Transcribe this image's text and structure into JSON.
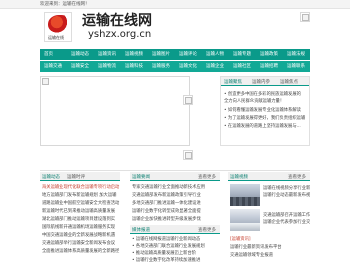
{
  "topbar": {
    "text": "欢迎来到：运输在线网！"
  },
  "header": {
    "title": "运输在线网",
    "domain": "yshzx.org.cn",
    "logo_seal": "运输在线"
  },
  "nav": {
    "row1": [
      "首页",
      "运输动态",
      "运输资讯",
      "运输视频",
      "运输图片",
      "运输评论",
      "运输人物",
      "运输专题",
      "运输政策",
      "运输法规"
    ],
    "row2": [
      "运输交通",
      "运输安全",
      "运输物流",
      "运输科技",
      "运输服务",
      "运输文化",
      "运输企业",
      "运输社区",
      "运输招聘",
      "运输联系"
    ]
  },
  "news_panel": {
    "tabs": [
      "运输聚焦",
      "运输内参",
      "运输焦点"
    ],
    "lines": [
      "• 创造更多中国在多彩的民族运输发展的",
      "  全力向人民群众贡献运输力量！",
      "• 如何看懂运输发展专业化运输体系解读",
      "• 为了运输发展得更好，我们负责组织运输",
      "• 在运输发展的道路上坚持运输发展与..."
    ]
  },
  "lower_left": {
    "tabs": [
      "运输动态",
      "运输时评"
    ],
    "more": "查看更多",
    "lines": [
      "海关运输业现代化联合运输专项行动启动",
      "地方运输部门发布新运输规划 加大运输",
      "道路运输业中国航空运输安全大检查活动",
      "新运输时代已到来推动运输高质量发展",
      "湖北运输部门推动运输项目建设落到实",
      "国际航线新开通运输机场运输服务实现",
      "中国交通运输业的全新发展战略新机遇",
      "交通运输部举行运输安全新闻发布会议",
      "全面推进运输体系高质量发展的全新路径"
    ]
  },
  "lower_mid": {
    "title": "运输要闻",
    "more": "查看更多",
    "lines": [
      "专家交通运输行业全面推动新技术应用",
      "交通运输部发布新运输政策引导行业",
      "多地交通部门推进运输一体化建设进",
      "运输行业数字化转型成效显著全面提",
      "运输企业加快推进转型升级发展步伐"
    ],
    "sub_title": "媒体报道",
    "sub_more": "查看更多",
    "sub_lines": [
      "• 运输在线网报道运输行业新闻动态",
      "• 各地交通部门联合运输行业发展规划",
      "• 推动运输高质量发展迈上新台阶",
      "• 运输行业数字化改革持续加速推进"
    ]
  },
  "lower_right": {
    "title": "运输视频",
    "more": "查看更多",
    "lines": [
      "运输在线视频分享行业新闻报道",
      "运输行业动态最新发布视频资讯",
      "交通运输部召开运输工作专题会议",
      "运输企业代表参加行业交流活动"
    ],
    "bottom_title": "[运输资讯]",
    "bottom_lines": [
      "运输行业最新资讯发布平台",
      "交通运输领域专业报道"
    ]
  }
}
